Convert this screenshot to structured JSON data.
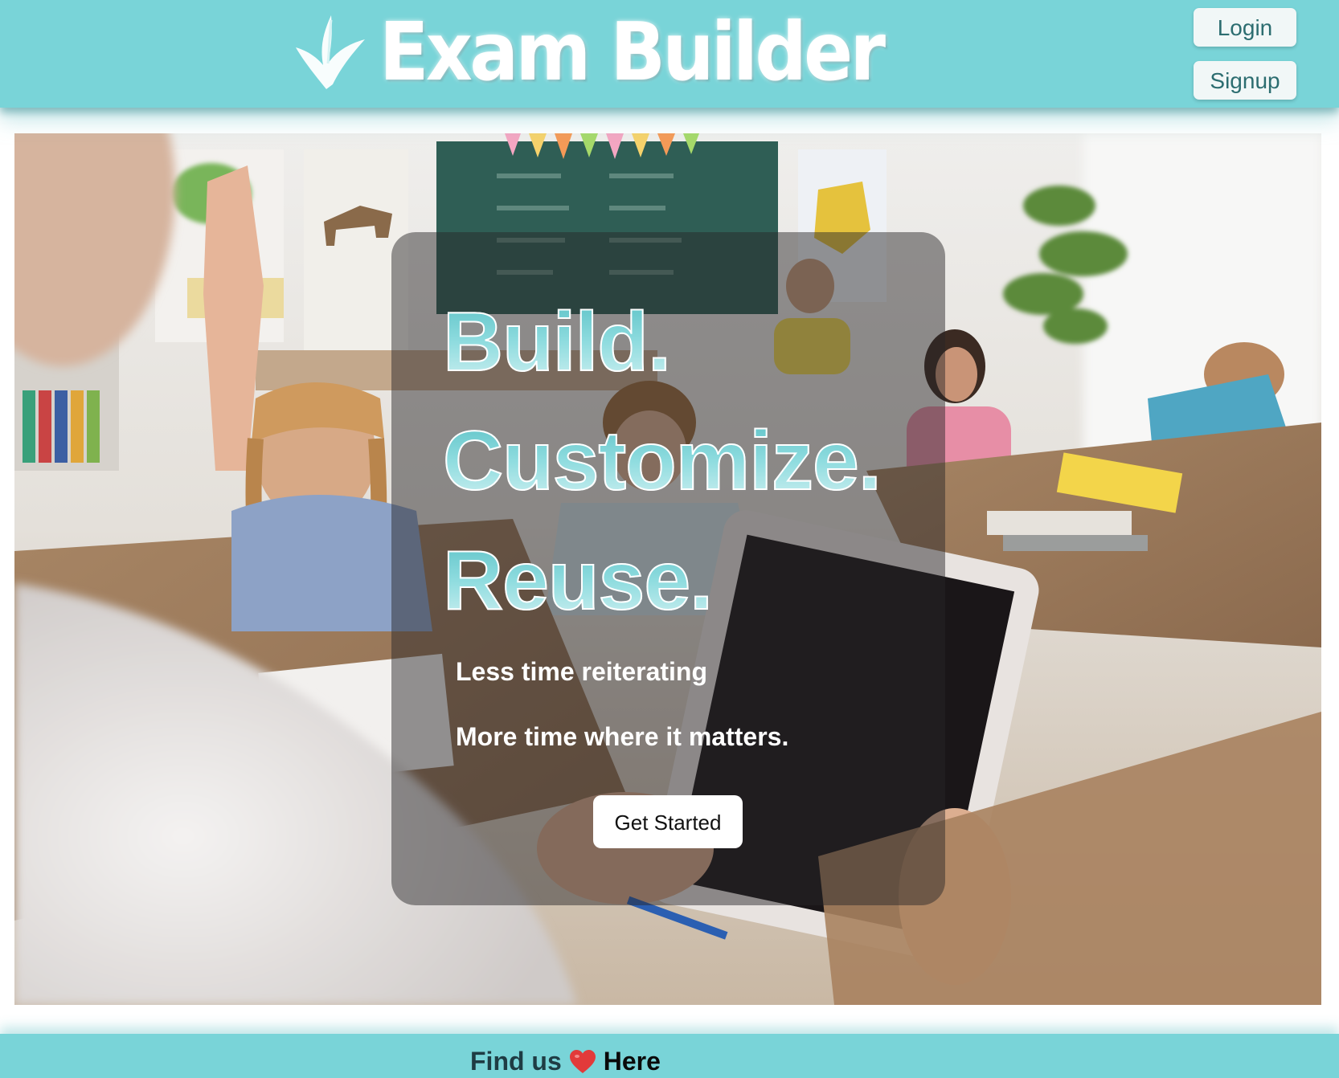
{
  "header": {
    "brand": "Exam Builder",
    "login_label": "Login",
    "signup_label": "Signup"
  },
  "hero": {
    "headline": [
      "Build.",
      "Customize.",
      "Reuse."
    ],
    "tagline_1": "Less time reiterating",
    "tagline_2": "More time where it matters.",
    "cta_label": "Get Started"
  },
  "footer": {
    "prefix": "Find us",
    "link_label": "Here"
  },
  "colors": {
    "header_bg": "#79d4d8",
    "accent": "#7ed0d3",
    "button_text": "#2c6d70"
  },
  "icons": {
    "logo": "feather-logo-icon",
    "heart": "heart-icon"
  }
}
